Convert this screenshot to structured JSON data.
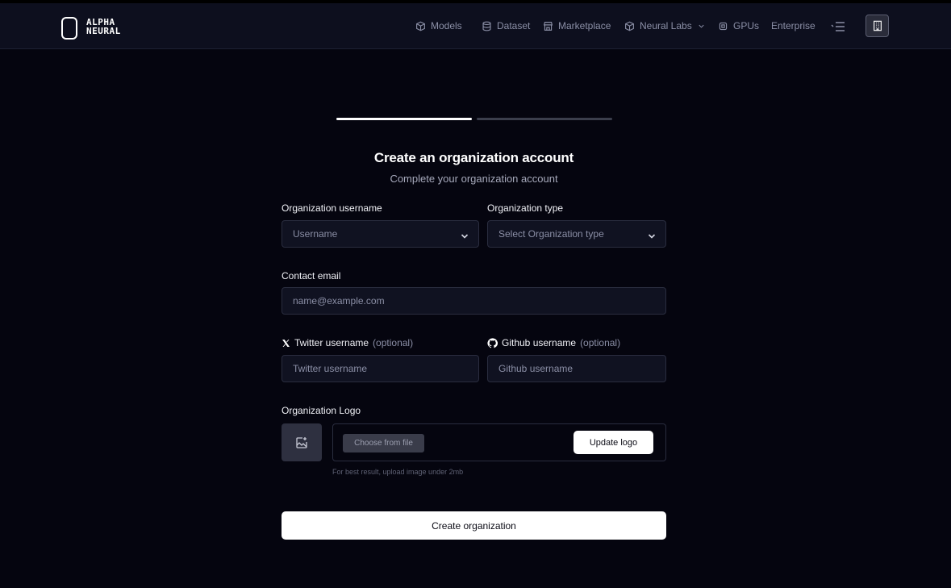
{
  "brand": {
    "line1": "ALPHA",
    "line2": "NEURAL"
  },
  "nav": {
    "items": [
      {
        "label": "Models",
        "icon": "cube-icon"
      },
      {
        "label": "Dataset",
        "icon": "database-icon"
      },
      {
        "label": "Marketplace",
        "icon": "store-icon"
      },
      {
        "label": "Neural Labs",
        "icon": "box-icon"
      },
      {
        "label": "GPUs",
        "icon": "chip-icon"
      },
      {
        "label": "Enterprise",
        "icon": ""
      }
    ]
  },
  "progress": {
    "step": 1,
    "total": 2
  },
  "form": {
    "title": "Create an organization account",
    "subtitle": "Complete your organization account",
    "username_label": "Organization username",
    "username_placeholder": "Username",
    "type_label": "Organization type",
    "type_placeholder": "Select Organization type",
    "email_label": "Contact email",
    "email_placeholder": "name@example.com",
    "twitter_label": "Twitter username",
    "twitter_optional": "(optional)",
    "twitter_placeholder": "Twitter username",
    "github_label": "Github username",
    "github_optional": "(optional)",
    "github_placeholder": "Github username",
    "logo_label": "Organization Logo",
    "choose_file": "Choose from file",
    "update_logo": "Update logo",
    "logo_hint": "For best result, upload image under 2mb",
    "submit": "Create organization"
  },
  "colors": {
    "background": "#05050f",
    "header": "#0d0f1e",
    "accent": "#ffffff",
    "muted": "#8b8fa6"
  }
}
